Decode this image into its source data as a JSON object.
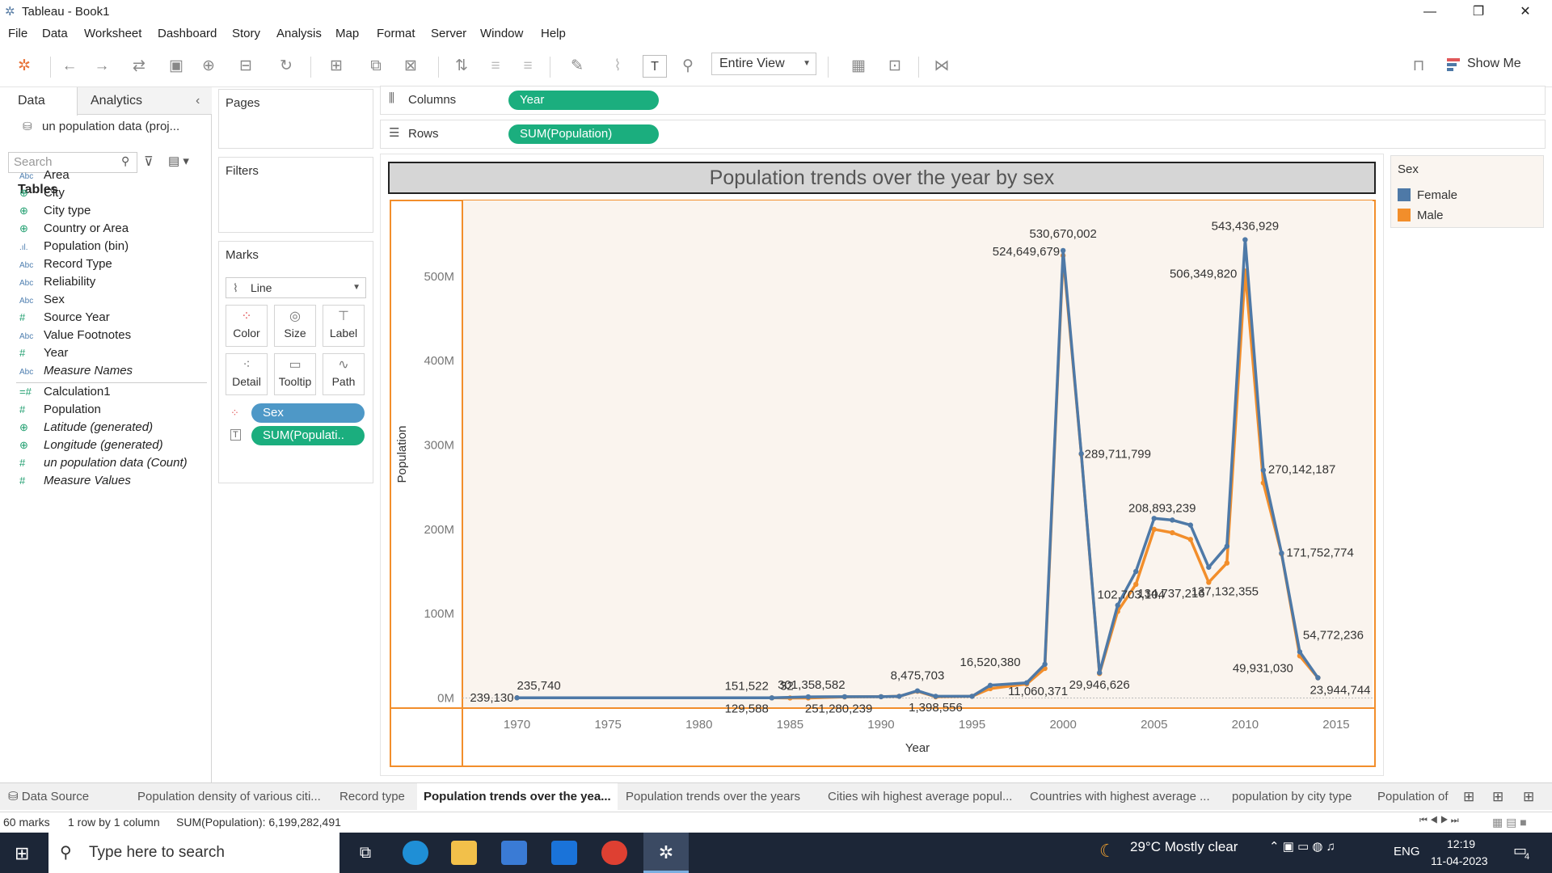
{
  "window": {
    "title": "Tableau - Book1",
    "minimize": "—",
    "restore": "❐",
    "close": "✕"
  },
  "menu": [
    "File",
    "Data",
    "Worksheet",
    "Dashboard",
    "Story",
    "Analysis",
    "Map",
    "Format",
    "Server",
    "Window",
    "Help"
  ],
  "toolbar": {
    "fit_select": "Entire View",
    "show_me": "Show Me"
  },
  "left_pane": {
    "tab_data": "Data",
    "tab_analytics": "Analytics",
    "datasource": "un population data (proj...",
    "search_placeholder": "Search",
    "tables_header": "Tables",
    "fields": [
      {
        "type": "Abc",
        "name": "Area",
        "italic": false
      },
      {
        "type": "globe",
        "name": "City",
        "italic": false
      },
      {
        "type": "globe",
        "name": "City type",
        "italic": false
      },
      {
        "type": "globe",
        "name": "Country or Area",
        "italic": false
      },
      {
        "type": "bin",
        "name": "Population (bin)",
        "italic": false
      },
      {
        "type": "Abc",
        "name": "Record Type",
        "italic": false
      },
      {
        "type": "Abc",
        "name": "Reliability",
        "italic": false
      },
      {
        "type": "Abc",
        "name": "Sex",
        "italic": false
      },
      {
        "type": "#",
        "name": "Source Year",
        "italic": false
      },
      {
        "type": "Abc",
        "name": "Value Footnotes",
        "italic": false
      },
      {
        "type": "#",
        "name": "Year",
        "italic": false
      },
      {
        "type": "Abc",
        "name": "Measure Names",
        "italic": true
      },
      {
        "type": "=#",
        "name": "Calculation1",
        "italic": false
      },
      {
        "type": "#",
        "name": "Population",
        "italic": false
      },
      {
        "type": "globe",
        "name": "Latitude (generated)",
        "italic": true
      },
      {
        "type": "globe",
        "name": "Longitude (generated)",
        "italic": true
      },
      {
        "type": "#",
        "name": "un population data (Count)",
        "italic": true
      },
      {
        "type": "#",
        "name": "Measure Values",
        "italic": true
      }
    ]
  },
  "cards": {
    "pages": "Pages",
    "filters": "Filters",
    "marks": "Marks",
    "mark_type": "Line",
    "mark_buttons": [
      "Color",
      "Size",
      "Label",
      "Detail",
      "Tooltip",
      "Path"
    ],
    "mark_pills": [
      "Sex",
      "SUM(Populati.."
    ]
  },
  "shelves": {
    "columns_label": "Columns",
    "columns_pill": "Year",
    "rows_label": "Rows",
    "rows_pill": "SUM(Population)"
  },
  "legend": {
    "title": "Sex",
    "items": [
      {
        "name": "Female",
        "color": "#4e79a7"
      },
      {
        "name": "Male",
        "color": "#f28e2b"
      }
    ]
  },
  "chart_data": {
    "type": "line",
    "title": "Population trends over the year by sex",
    "xlabel": "Year",
    "ylabel": "Population",
    "xlim": [
      1967,
      2017
    ],
    "ylim": [
      -12000000,
      590000000
    ],
    "x_ticks": [
      1970,
      1975,
      1980,
      1985,
      1990,
      1995,
      2000,
      2005,
      2010,
      2015
    ],
    "y_ticks": [
      {
        "v": 0,
        "label": "0M"
      },
      {
        "v": 100000000,
        "label": "100M"
      },
      {
        "v": 200000000,
        "label": "200M"
      },
      {
        "v": 300000000,
        "label": "300M"
      },
      {
        "v": 400000000,
        "label": "400M"
      },
      {
        "v": 500000000,
        "label": "500M"
      }
    ],
    "series": [
      {
        "name": "Female",
        "color": "#4e79a7",
        "points": [
          [
            1970,
            235740
          ],
          [
            1984,
            151522
          ],
          [
            1986,
            1358582
          ],
          [
            1988,
            1500000
          ],
          [
            1990,
            1500000
          ],
          [
            1991,
            2000000
          ],
          [
            1992,
            8475703
          ],
          [
            1993,
            2000000
          ],
          [
            1995,
            2000000
          ],
          [
            1996,
            15000000
          ],
          [
            1998,
            18000000
          ],
          [
            1999,
            40000000
          ],
          [
            2000,
            530670002
          ],
          [
            2001,
            289711799
          ],
          [
            2002,
            29946626
          ],
          [
            2003,
            110000000
          ],
          [
            2004,
            150000000
          ],
          [
            2005,
            213000000
          ],
          [
            2006,
            211000000
          ],
          [
            2007,
            205000000
          ],
          [
            2008,
            155000000
          ],
          [
            2009,
            180000000
          ],
          [
            2010,
            543436929
          ],
          [
            2011,
            270142187
          ],
          [
            2012,
            171752774
          ],
          [
            2013,
            54772236
          ],
          [
            2014,
            23944744
          ]
        ]
      },
      {
        "name": "Male",
        "color": "#f28e2b",
        "points": [
          [
            1970,
            239130
          ],
          [
            1984,
            129588
          ],
          [
            1985,
            32
          ],
          [
            1986,
            251
          ],
          [
            1988,
            1280239
          ],
          [
            1990,
            1500000
          ],
          [
            1991,
            2000000
          ],
          [
            1992,
            8000000
          ],
          [
            1993,
            1398556
          ],
          [
            1995,
            2000000
          ],
          [
            1996,
            11060371
          ],
          [
            1998,
            16520380
          ],
          [
            1999,
            35000000
          ],
          [
            2000,
            524649679
          ],
          [
            2001,
            289000000
          ],
          [
            2002,
            29000000
          ],
          [
            2003,
            102703104
          ],
          [
            2004,
            134737216
          ],
          [
            2005,
            200000000
          ],
          [
            2006,
            196000000
          ],
          [
            2007,
            188000000
          ],
          [
            2008,
            137132355
          ],
          [
            2009,
            160000000
          ],
          [
            2010,
            506349820
          ],
          [
            2011,
            255000000
          ],
          [
            2012,
            171000000
          ],
          [
            2013,
            49931030
          ],
          [
            2014,
            23944744
          ]
        ]
      }
    ],
    "data_labels": [
      "235,740",
      "239,130",
      "151,522",
      "129,588",
      "32",
      "301,358,582",
      "251,280,239",
      "8,475,703",
      "1,398,556",
      "16,520,380",
      "11,060,371",
      "530,670,002",
      "524,649,679",
      "289,711,799",
      "29,946,626",
      "102,703,104",
      "134,737,216",
      "208,893,239",
      "137,132,355",
      "543,436,929",
      "506,349,820",
      "270,142,187",
      "171,752,774",
      "54,772,236",
      "49,931,030",
      "23,944,744"
    ]
  },
  "sheet_tabs": {
    "datasource": "Data Source",
    "tabs": [
      "Population density of various citi...",
      "Record type",
      "Population trends over the yea...",
      "Population trends over the years",
      "Cities wih highest average popul...",
      "Countries with highest average ...",
      "population by city type",
      "Population of"
    ]
  },
  "status": {
    "marks": "60 marks",
    "rowcol": "1 row by 1 column",
    "sum": "SUM(Population): 6,199,282,491"
  },
  "taskbar": {
    "search": "Type here to search",
    "weather": "29°C  Mostly clear",
    "lang": "ENG",
    "time": "12:19",
    "date": "11-04-2023",
    "notif": "4"
  }
}
